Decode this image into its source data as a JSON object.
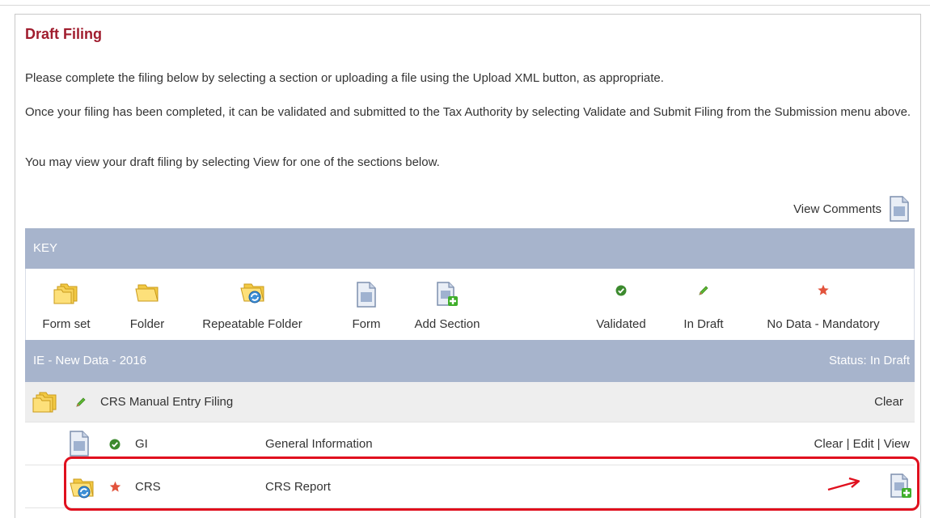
{
  "title": "Draft Filing",
  "intro": {
    "p1": "Please complete the filing below by selecting a section or uploading a file using the Upload XML button, as appropriate.",
    "p2": "Once your filing has been completed, it can be validated and submitted to the Tax Authority by selecting Validate and Submit Filing from the Submission menu above.",
    "p3": "You may view your draft filing by selecting View for one of the sections below."
  },
  "view_comments": {
    "label": "View Comments",
    "icon": "document-icon"
  },
  "key": {
    "heading": "KEY",
    "items": [
      {
        "label": "Form set",
        "icon": "form-set-folder-icon"
      },
      {
        "label": "Folder",
        "icon": "folder-icon"
      },
      {
        "label": "Repeatable Folder",
        "icon": "repeatable-folder-icon"
      },
      {
        "label": "Form",
        "icon": "form-document-icon"
      },
      {
        "label": "Add Section",
        "icon": "add-section-icon"
      },
      {
        "label": "Validated",
        "icon": "validated-check-icon"
      },
      {
        "label": "In Draft",
        "icon": "pencil-icon"
      },
      {
        "label": "No Data - Mandatory",
        "icon": "star-icon"
      }
    ]
  },
  "section": {
    "name": "IE - New Data - 2016",
    "status": "Status: In Draft"
  },
  "filing": {
    "name": "CRS Manual Entry Filing",
    "action": "Clear"
  },
  "rows": [
    {
      "code": "GI",
      "description": "General Information",
      "status": "validated",
      "actions": {
        "clear": "Clear",
        "sep1": "|",
        "edit": "Edit",
        "sep2": "|",
        "view": "View"
      }
    },
    {
      "code": "CRS",
      "description": "CRS Report",
      "status": "no-data-mandatory"
    }
  ],
  "colors": {
    "title": "#a01d2e",
    "bar": "#a7b4cc",
    "highlight": "#e0101e",
    "validated": "#3c8a2e",
    "star": "#e2533c"
  }
}
